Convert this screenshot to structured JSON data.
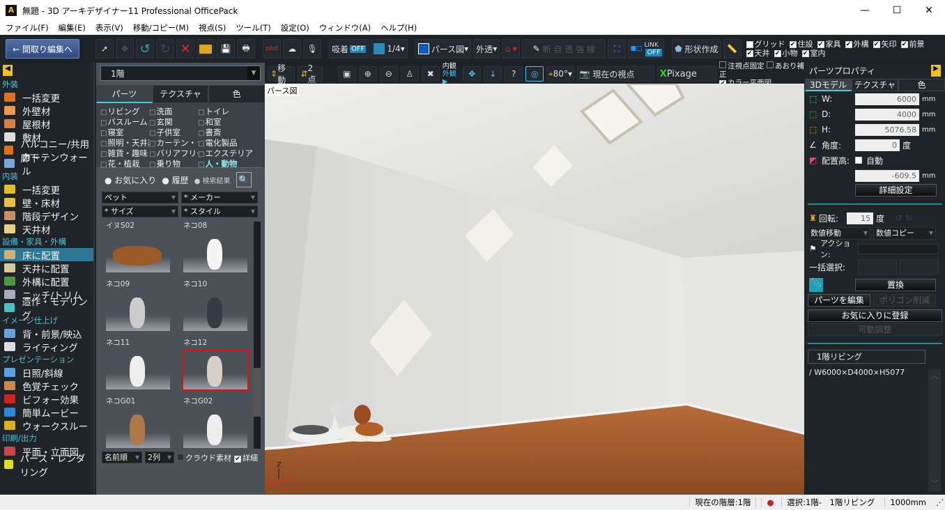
{
  "window": {
    "title": "無題 - 3D アーキデザイナー11 Professional OfficePack",
    "min": "—",
    "max": "☐",
    "close": "✕"
  },
  "menu": [
    "ファイル(F)",
    "編集(E)",
    "表示(V)",
    "移動/コピー(M)",
    "視点(S)",
    "ツール(T)",
    "設定(O)",
    "ウィンドウ(A)",
    "ヘルプ(H)"
  ],
  "toolbar": {
    "back": "← 間取り編集へ",
    "snap": "吸着",
    "snap_state": "OFF",
    "grid_scale": "1/4",
    "view_mode": "パース図",
    "transparency": "外透",
    "wall_modes": "断 自 透 強 線",
    "link": "LINK",
    "link_state": "OFF",
    "shape_create": "形状作成",
    "checks": [
      {
        "label": "グリッド",
        "checked": false
      },
      {
        "label": "住設",
        "checked": true
      },
      {
        "label": "家具",
        "checked": true
      },
      {
        "label": "外構",
        "checked": true
      },
      {
        "label": "矢印",
        "checked": true
      },
      {
        "label": "前景",
        "checked": true
      },
      {
        "label": "天井",
        "checked": true
      },
      {
        "label": "小物",
        "checked": true
      },
      {
        "label": "室内",
        "checked": true
      }
    ]
  },
  "sidebar": {
    "sections": [
      {
        "title": "外装",
        "items": [
          "一括変更",
          "外壁材",
          "屋根材",
          "敷材",
          "バルコニー/共用廊下",
          "カーテンウォール"
        ]
      },
      {
        "title": "内装",
        "items": [
          "一括変更",
          "壁・床材",
          "階段デザイン",
          "天井材"
        ]
      },
      {
        "title": "設備・家具・外構",
        "items": [
          "床に配置",
          "天井に配置",
          "外構に配置",
          "ニッチ/トリム",
          "造作・モデリング"
        ]
      },
      {
        "title": "イメージ仕上げ",
        "items": [
          "背・前景/映込",
          "ライティング"
        ]
      },
      {
        "title": "プレゼンテーション",
        "items": [
          "日照/斜線",
          "色覚チェック",
          "ビフォー効果",
          "簡単ムービー",
          "ウォークスルー"
        ]
      },
      {
        "title": "印刷/出力",
        "items": [
          "平面・立面図",
          "パース・レンダリング"
        ]
      }
    ],
    "selected": "床に配置"
  },
  "parts": {
    "floor": "1階",
    "tabs": [
      "パーツ",
      "テクスチャ",
      "色"
    ],
    "active_tab": "パーツ",
    "categories": [
      "リビング",
      "洗面",
      "トイレ",
      "バスルーム",
      "玄関",
      "和室",
      "寝室",
      "子供室",
      "書斎",
      "照明・天井器具",
      "カーテン・ラグ",
      "電化製品",
      "雑貨・趣味",
      "バリアフリー",
      "エクステリア",
      "花・植栽",
      "乗り物",
      "人・動物"
    ],
    "active_category": "人・動物",
    "filters": {
      "favorites": "お気に入り",
      "history": "履歴",
      "search_results": "検索結果"
    },
    "selects": [
      "ペット",
      "* メーカー",
      "* サイズ",
      "* スタイル"
    ],
    "items": [
      "イヌS02",
      "ネコ08",
      "ネコ09",
      "ネコ10",
      "ネコ11",
      "ネコ12",
      "ネコG01",
      "ネコG02"
    ],
    "selected_item": "ネコ12",
    "sort": "名前順",
    "columns": "2列",
    "cloud": "クラウド素材",
    "cloud_checked": false,
    "detail": "詳細",
    "detail_checked": true
  },
  "viewport": {
    "move": "移動",
    "two_point": "2点",
    "inside": "内観",
    "outside": "外観",
    "fov": "80°",
    "camera": "現在の視点",
    "renderer": "Pixage",
    "fix_target": "注視点固定",
    "fix_target_checked": false,
    "tilt": "あおり補正",
    "tilt_checked": false,
    "color_plan": "カラー平面図",
    "color_plan_checked": true,
    "label": "パース図",
    "axes": {
      "z": "Z",
      "y": "Y",
      "x": "X"
    }
  },
  "properties": {
    "title": "パーツプロパティ",
    "tabs": [
      "3Dモデル",
      "テクスチャ",
      "色"
    ],
    "w_label": "W:",
    "w": "6000",
    "d_label": "D:",
    "d": "4000",
    "h_label": "H:",
    "h": "5076.58",
    "unit": "mm",
    "angle_label": "角度:",
    "angle": "0",
    "deg": "度",
    "height_label": "配置高:",
    "auto": "自動",
    "height": "-609.5",
    "detail_btn": "詳細設定",
    "rotate_label": "回転:",
    "rotate": "15",
    "move_num": "数値移動",
    "copy_num": "数値コピー",
    "action": "アクション:",
    "batch": "一括選択:",
    "replace": "置換",
    "edit_parts": "パーツを編集",
    "reduce": "ポリゴン削減",
    "fav_register": "お気に入りに登録",
    "motion": "可動調整",
    "room": "1階リビング",
    "room_size": "/ W6000×D4000×H5077"
  },
  "status": {
    "floor": "現在の階層:1階",
    "selection": "選択:1階-　1階リビング",
    "scale": "1000mm"
  }
}
